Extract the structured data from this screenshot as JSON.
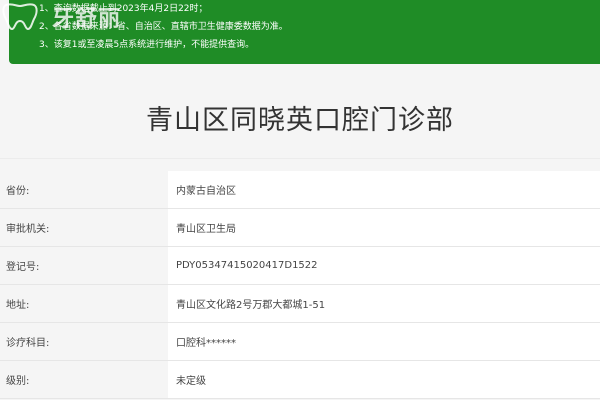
{
  "notice": {
    "lines": [
      "1、查询数据截止到2023年4月2日22时；",
      "2、各省数据来源：省、自治区、直辖市卫生健康委数据为准。",
      "3、该复1或至凌晨5点系统进行维护，不能提供查询。"
    ]
  },
  "logo": {
    "text": "牙舒丽",
    "icon": "tooth-logo-icon"
  },
  "clinic": {
    "title": "青山区同晓英口腔门诊部"
  },
  "details": [
    {
      "label": "省份:",
      "value": "内蒙古自治区"
    },
    {
      "label": "审批机关:",
      "value": "青山区卫生局"
    },
    {
      "label": "登记号:",
      "value": "PDY05347415020417D1522"
    },
    {
      "label": "地址:",
      "value": "青山区文化路2号万郡大都城1-51"
    },
    {
      "label": "诊疗科目:",
      "value": "口腔科******"
    },
    {
      "label": "级别:",
      "value": "未定级"
    }
  ],
  "colors": {
    "notice_bg": "#1f8c26",
    "page_bg": "#f5f5f5"
  }
}
